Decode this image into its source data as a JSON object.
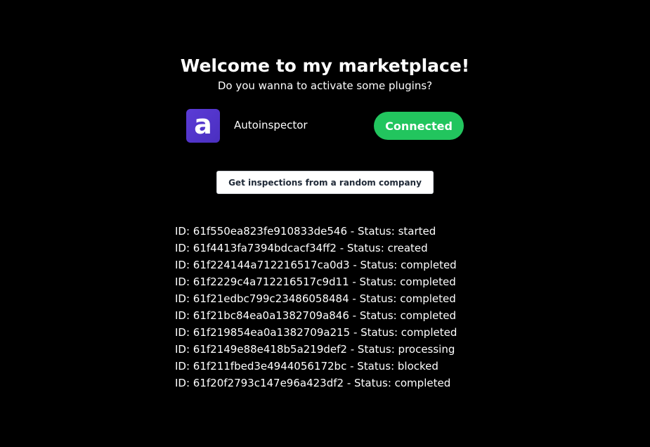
{
  "header": {
    "title": "Welcome to my marketplace!",
    "subtitle": "Do you wanna to activate some plugins?"
  },
  "plugin": {
    "logo_letter": "a",
    "logo_icon": "autoinspector-logo-icon",
    "name": "Autoinspector",
    "status_button": "Connected",
    "colors": {
      "logo_bg": "#5b3bd6",
      "status_bg": "#22c55e"
    }
  },
  "actions": {
    "random_inspections_label": "Get inspections from a random company"
  },
  "inspections": [
    "ID: 61f550ea823fe910833de546 - Status: started",
    "ID: 61f4413fa7394bdcacf34ff2 - Status: created",
    "ID: 61f224144a712216517ca0d3 - Status: completed",
    "ID: 61f2229c4a712216517c9d11 - Status: completed",
    "ID: 61f21edbc799c23486058484 - Status: completed",
    "ID: 61f21bc84ea0a1382709a846 - Status: completed",
    "ID: 61f219854ea0a1382709a215 - Status: completed",
    "ID: 61f2149e88e418b5a219def2 - Status: processing",
    "ID: 61f211fbed3e4944056172bc - Status: blocked",
    "ID: 61f20f2793c147e96a423df2 - Status: completed"
  ]
}
